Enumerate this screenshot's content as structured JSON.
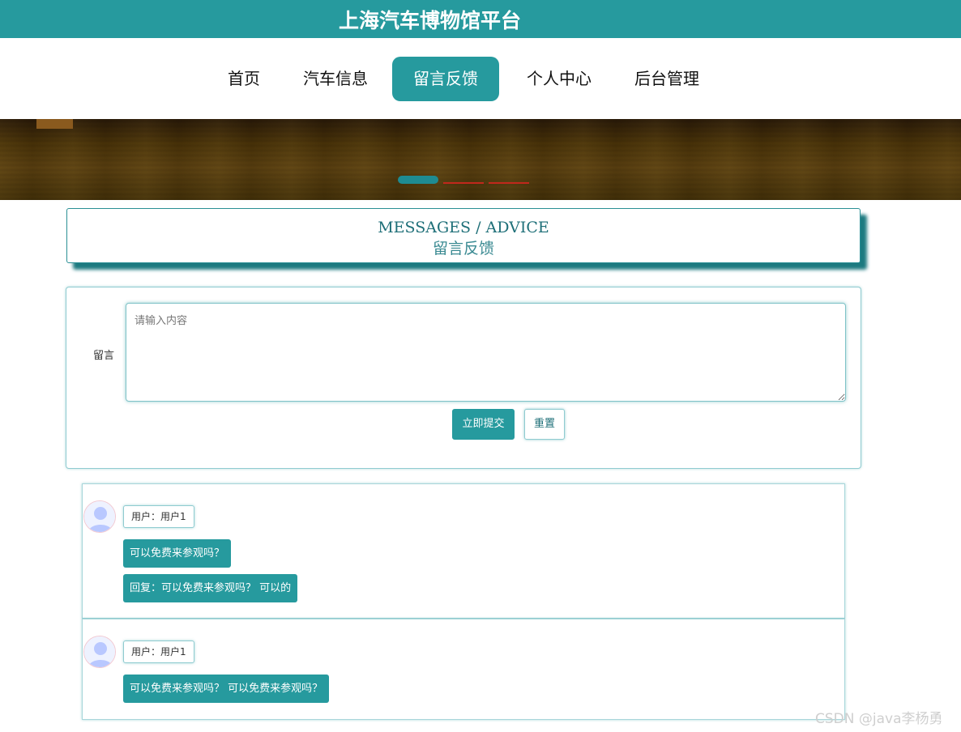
{
  "header": {
    "site_title": "上海汽车博物馆平台"
  },
  "nav": {
    "items": [
      {
        "label": "首页",
        "active": false
      },
      {
        "label": "汽车信息",
        "active": false
      },
      {
        "label": "留言反馈",
        "active": true
      },
      {
        "label": "个人中心",
        "active": false
      },
      {
        "label": "后台管理",
        "active": false
      }
    ]
  },
  "banner": {
    "slides": 3,
    "active_slide": 1
  },
  "section_title": {
    "english": "MESSAGES / ADVICE",
    "chinese": "留言反馈"
  },
  "form": {
    "label": "留言",
    "textarea_placeholder": "请输入内容",
    "submit_label": "立即提交",
    "reset_label": "重置"
  },
  "messages": [
    {
      "user": "用户：用户1",
      "content": "可以免费来参观吗？",
      "reply": "回复：可以免费来参观吗？ 可以的"
    },
    {
      "user": "用户：用户1",
      "content": "可以免费来参观吗？ 可以免费来参观吗？",
      "reply": ""
    }
  ],
  "watermark": "CSDN @java李杨勇",
  "colors": {
    "primary": "#269a9e",
    "inactive_dot": "#c0281c"
  }
}
